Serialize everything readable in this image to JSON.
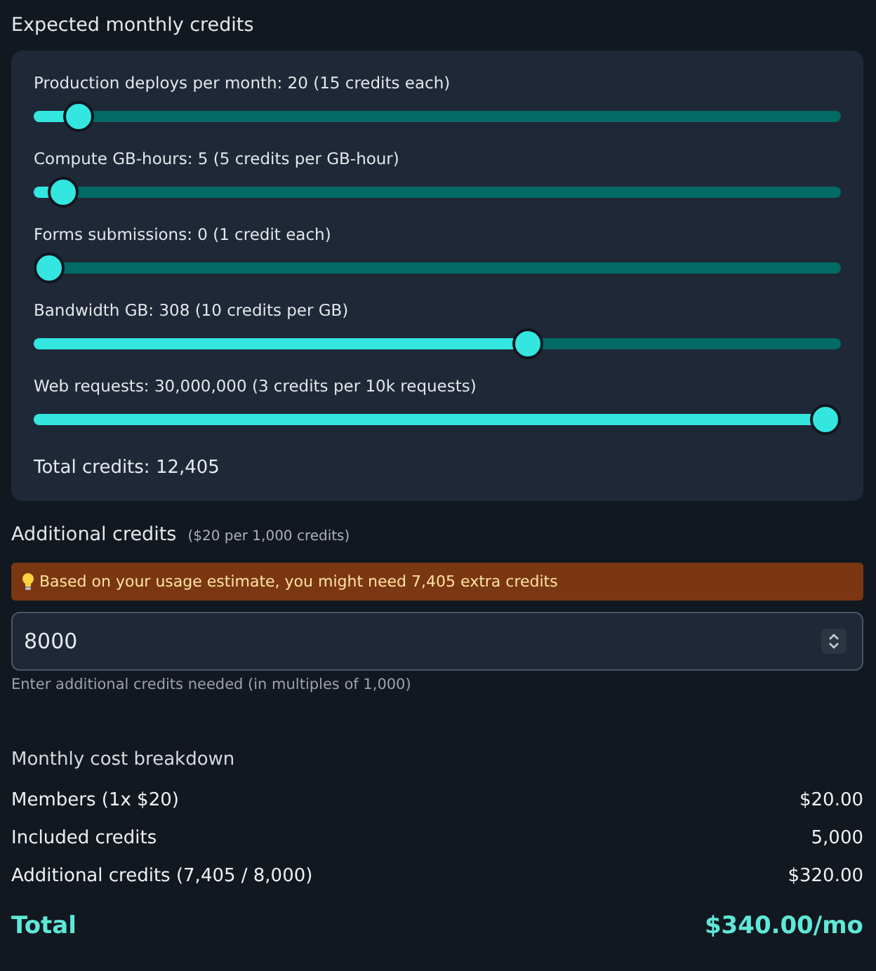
{
  "title": "Expected monthly credits",
  "sliders": [
    {
      "label": "Production deploys per month: 20 (15 credits each)",
      "level": 0.038
    },
    {
      "label": "Compute GB-hours: 5 (5 credits per GB-hour)",
      "level": 0.018
    },
    {
      "label": "Forms submissions: 0 (1 credit each)",
      "level": 0
    },
    {
      "label": "Bandwidth GB: 308 (10 credits per GB)",
      "level": 0.616
    },
    {
      "label": "Web requests: 30,000,000 (3 credits per 10k requests)",
      "level": 1
    }
  ],
  "total_credits": "Total credits: 12,405",
  "additional": {
    "title": "Additional credits",
    "note": "($20 per 1,000 credits)",
    "alert": "Based on your usage estimate, you might need 7,405 extra credits",
    "value": "8000",
    "help": "Enter additional credits needed (in multiples of 1,000)"
  },
  "breakdown": {
    "title": "Monthly cost breakdown",
    "rows": [
      {
        "label": "Members (1x $20)",
        "value": "$20.00"
      },
      {
        "label": "Included credits",
        "value": "5,000"
      },
      {
        "label": "Additional credits (7,405 / 8,000)",
        "value": "$320.00"
      }
    ],
    "total": {
      "label": "Total",
      "value": "$340.00/mo"
    }
  }
}
